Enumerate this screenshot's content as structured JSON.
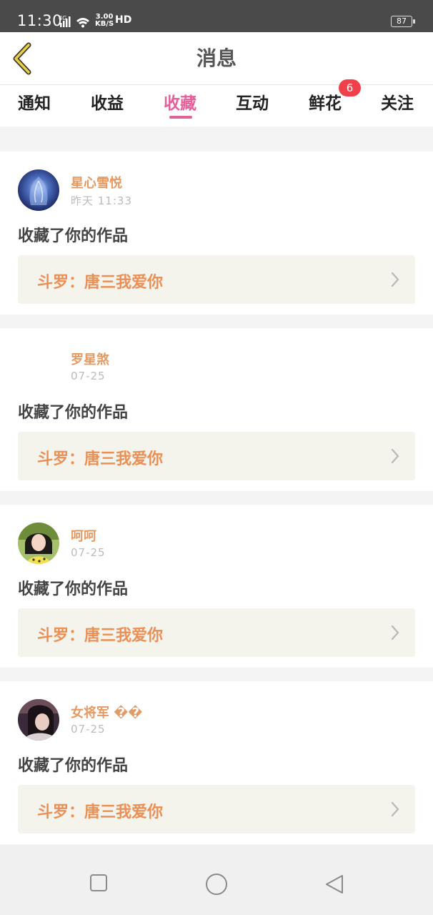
{
  "status_bar": {
    "time": "11:30",
    "network": "4G",
    "speed_value": "3.00",
    "speed_unit": "KB/S",
    "hd": "HD",
    "battery": "87"
  },
  "header": {
    "title": "消息"
  },
  "tabs": [
    {
      "label": "通知"
    },
    {
      "label": "收益"
    },
    {
      "label": "收藏",
      "active": true
    },
    {
      "label": "互动"
    },
    {
      "label": "鲜花",
      "badge": "6"
    },
    {
      "label": "关注"
    }
  ],
  "messages": [
    {
      "user": "星心雪悦",
      "time": "昨天 11:33",
      "action": "收藏了你的作品",
      "work": "斗罗：唐三我爱你",
      "avatar": "avatar-blue"
    },
    {
      "user": "罗星煞",
      "time": "07-25",
      "action": "收藏了你的作品",
      "work": "斗罗：唐三我爱你",
      "avatar": "none"
    },
    {
      "user": "呵呵",
      "time": "07-25",
      "action": "收藏了你的作品",
      "work": "斗罗：唐三我爱你",
      "avatar": "avatar-girl"
    },
    {
      "user": "女将军 ��",
      "time": "07-25",
      "action": "收藏了你的作品",
      "work": "斗罗：唐三我爱你",
      "avatar": "avatar-dark"
    }
  ],
  "colors": {
    "accent": "#e4609a",
    "username": "#e69a63",
    "work_title": "#eb8f55",
    "badge": "#f0414a"
  }
}
